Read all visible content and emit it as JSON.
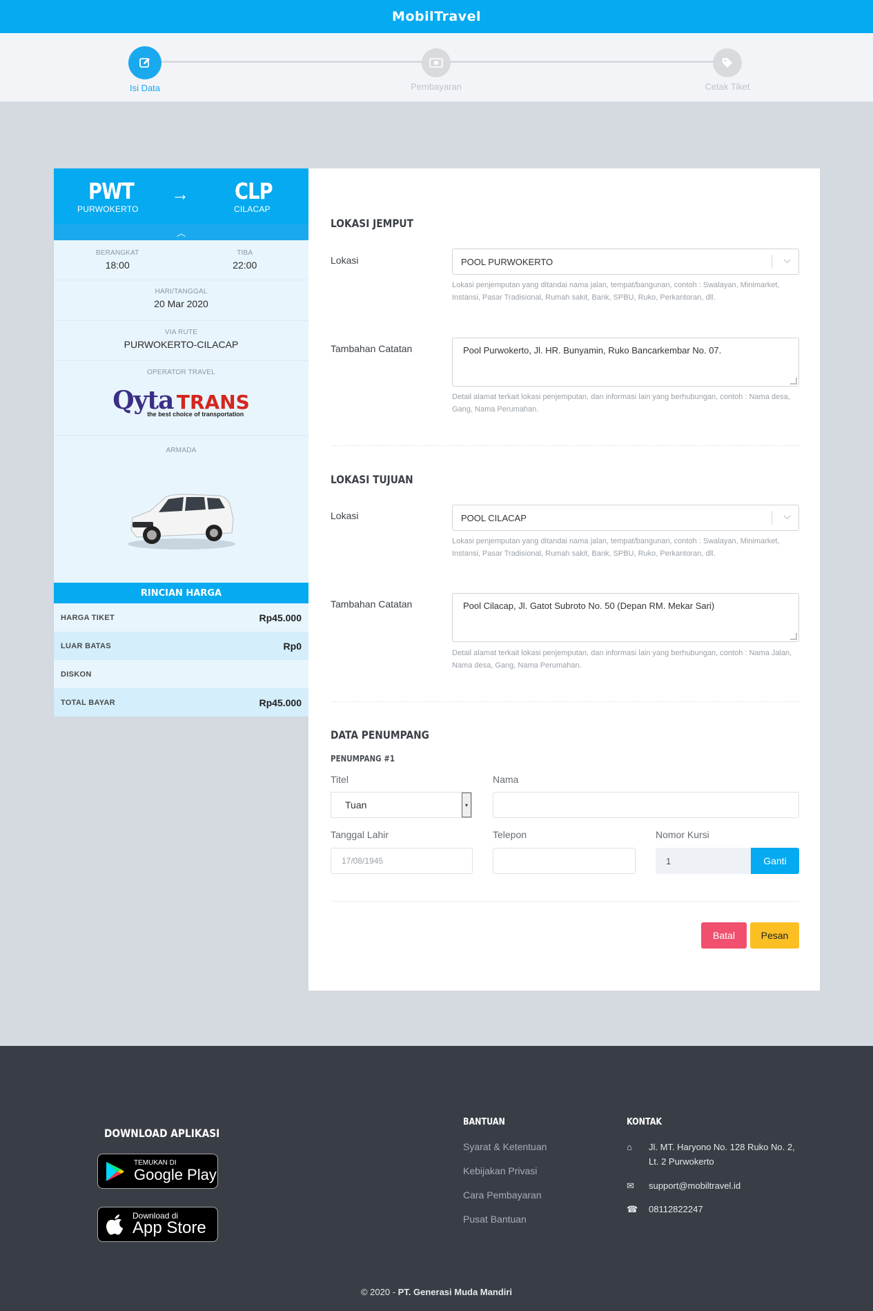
{
  "app": {
    "brand": "MobilTravel"
  },
  "colors": {
    "primary": "#06aaf0",
    "danger": "#f0506e",
    "warning": "#fbbf24",
    "footer_bg": "#393d45",
    "page_bg": "#d5dae1"
  },
  "stepper": {
    "steps": [
      {
        "label": "Isi Data",
        "icon": "edit-icon",
        "active": true
      },
      {
        "label": "Pembayaran",
        "icon": "money-icon",
        "active": false
      },
      {
        "label": "Cetak Tiket",
        "icon": "tag-icon",
        "active": false
      }
    ]
  },
  "trip": {
    "origin_code": "PWT",
    "origin_city": "PURWOKERTO",
    "dest_code": "CLP",
    "dest_city": "CILACAP",
    "depart_label": "BERANGKAT",
    "depart_time": "18:00",
    "arrive_label": "TIBA",
    "arrive_time": "22:00",
    "date_label": "HARI/TANGGAL",
    "date": "20 Mar 2020",
    "route_label": "VIA RUTE",
    "route": "PURWOKERTO-CILACAP",
    "operator_label": "OPERATOR TRAVEL",
    "operator_logo": {
      "name_part1": "Qyta",
      "name_part2": "TRANS",
      "tagline": "the best choice of transportation"
    },
    "armada_label": "ARMADA"
  },
  "price": {
    "title": "RINCIAN HARGA",
    "rows": [
      {
        "label": "HARGA TIKET",
        "value": "Rp45.000"
      },
      {
        "label": "LUAR BATAS",
        "value": "Rp0"
      },
      {
        "label": "DISKON",
        "value": ""
      },
      {
        "label": "TOTAL BAYAR",
        "value": "Rp45.000"
      }
    ]
  },
  "pickup": {
    "title": "LOKASI JEMPUT",
    "location_label": "Lokasi",
    "location_value": "POOL PURWOKERTO",
    "location_help": "Lokasi penjemputan yang ditandai nama jalan, tempat/bangunan, contoh : Swalayan, Minimarket, Instansi, Pasar Tradisional, Rumah sakit, Bank, SPBU, Ruko, Perkantoran, dll.",
    "note_label": "Tambahan Catatan",
    "note_value": "Pool Purwokerto, Jl. HR. Bunyamin, Ruko Bancarkembar No. 07.",
    "note_help": "Detail alamat terkait lokasi penjemputan, dan informasi lain yang berhubungan, contoh : Nama desa, Gang, Nama Perumahan."
  },
  "destination": {
    "title": "LOKASI TUJUAN",
    "location_label": "Lokasi",
    "location_value": "POOL CILACAP",
    "location_help": "Lokasi penjemputan yang ditandai nama jalan, tempat/bangunan, contoh : Swalayan, Minimarket, Instansi, Pasar Tradisional, Rumah sakit, Bank, SPBU, Ruko, Perkantoran, dll.",
    "note_label": "Tambahan Catatan",
    "note_value": "Pool Cilacap, Jl. Gatot Subroto No. 50 (Depan RM. Mekar Sari)",
    "note_help": "Detail alamat terkait lokasi penjemputan, dan informasi lain yang berhubungan, contoh : Nama Jalan, Nama desa, Gang, Nama Perumahan."
  },
  "passenger": {
    "title": "DATA PENUMPANG",
    "subtitle": "PENUMPANG #1",
    "titel_label": "Titel",
    "titel_value": "Tuan",
    "nama_label": "Nama",
    "nama_value": "",
    "dob_label": "Tanggal Lahir",
    "dob_placeholder": "17/08/1945",
    "phone_label": "Telepon",
    "phone_value": "",
    "seat_label": "Nomor Kursi",
    "seat_value": "1",
    "change_button": "Ganti"
  },
  "actions": {
    "cancel": "Batal",
    "order": "Pesan"
  },
  "footer": {
    "download_title": "DOWNLOAD APLIKASI",
    "google_play": {
      "small": "TEMUKAN DI",
      "big": "Google Play"
    },
    "app_store": {
      "small": "Download di",
      "big": "App Store"
    },
    "help_title": "BANTUAN",
    "help_links": [
      "Syarat & Ketentuan",
      "Kebijakan Privasi",
      "Cara Pembayaran",
      "Pusat Bantuan"
    ],
    "contact_title": "KONTAK",
    "address": "Jl. MT. Haryono No. 128 Ruko No. 2, Lt. 2 Purwokerto",
    "email": "support@mobiltravel.id",
    "phone": "08112822247",
    "copyright_prefix": "© 2020 - ",
    "copyright_company": "PT. Generasi Muda Mandiri"
  }
}
